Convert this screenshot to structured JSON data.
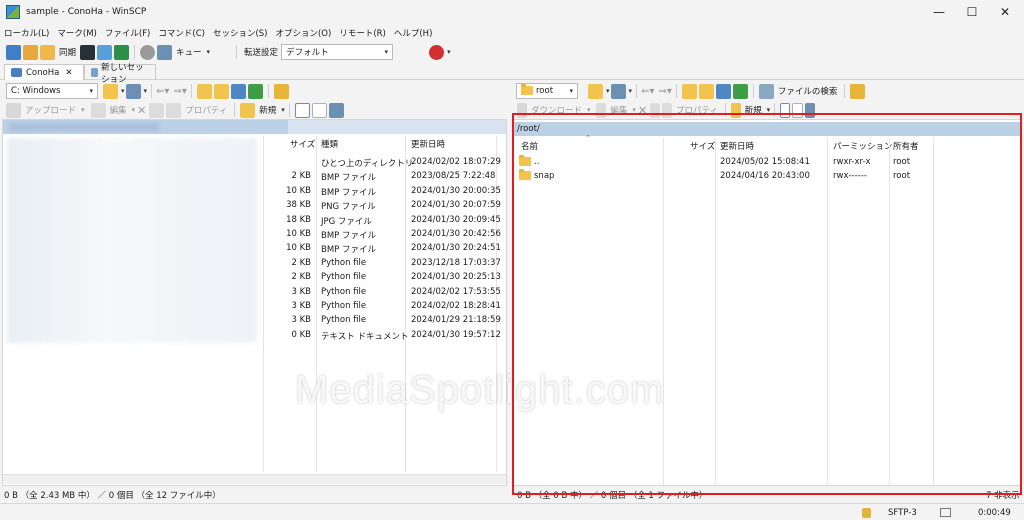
{
  "window": {
    "title": "sample - ConoHa - WinSCP",
    "minimize": "—",
    "maximize": "☐",
    "close": "✕"
  },
  "menu": [
    "ローカル(L)",
    "マーク(M)",
    "ファイル(F)",
    "コマンド(C)",
    "セッション(S)",
    "オプション(O)",
    "リモート(R)",
    "ヘルプ(H)"
  ],
  "toolbar_main": {
    "sync_label": "同期",
    "queue_label": "キュー",
    "transfer_label": "転送設定",
    "transfer_value": "デフォルト"
  },
  "tabs": {
    "session": "ConoHa",
    "session_close": "✕",
    "new_session": "新しいセッション"
  },
  "local": {
    "drive": "C: Windows",
    "upload": "アップロード",
    "edit": "編集",
    "properties": "プロパティ",
    "new": "新規",
    "columns": {
      "size": "サイズ",
      "type": "種類",
      "modified": "更新日時"
    },
    "rows": [
      {
        "size": "",
        "type": "ひとつ上のディレクトリ",
        "modified": "2024/02/02  18:07:29"
      },
      {
        "size": "2 KB",
        "type": "BMP ファイル",
        "modified": "2023/08/25   7:22:48"
      },
      {
        "size": "10 KB",
        "type": "BMP ファイル",
        "modified": "2024/01/30  20:00:35"
      },
      {
        "size": "38 KB",
        "type": "PNG ファイル",
        "modified": "2024/01/30  20:07:59"
      },
      {
        "size": "18 KB",
        "type": "JPG ファイル",
        "modified": "2024/01/30  20:09:45"
      },
      {
        "size": "10 KB",
        "type": "BMP ファイル",
        "modified": "2024/01/30  20:42:56"
      },
      {
        "size": "10 KB",
        "type": "BMP ファイル",
        "modified": "2024/01/30  20:24:51"
      },
      {
        "size": "2 KB",
        "type": "Python file",
        "modified": "2023/12/18  17:03:37"
      },
      {
        "size": "2 KB",
        "type": "Python file",
        "modified": "2024/01/30  20:25:13"
      },
      {
        "size": "3 KB",
        "type": "Python file",
        "modified": "2024/02/02  17:53:55"
      },
      {
        "size": "3 KB",
        "type": "Python file",
        "modified": "2024/02/02  18:28:41"
      },
      {
        "size": "3 KB",
        "type": "Python file",
        "modified": "2024/01/29  21:18:59"
      },
      {
        "size": "0 KB",
        "type": "テキスト ドキュメント",
        "modified": "2024/01/30  19:57:12"
      }
    ],
    "status": "0 B （全 2.43 MB 中） ／ 0 個目 （全 12 ファイル中）"
  },
  "remote": {
    "dir": "root",
    "find_files": "ファイルの検索",
    "download": "ダウンロード",
    "edit": "編集",
    "properties": "プロパティ",
    "new": "新規",
    "path": "/root/",
    "columns": {
      "name": "名前",
      "size": "サイズ",
      "modified": "更新日時",
      "permissions": "パーミッション",
      "owner": "所有者"
    },
    "rows": [
      {
        "name": "..",
        "size": "",
        "modified": "2024/05/02 15:08:41",
        "permissions": "rwxr-xr-x",
        "owner": "root"
      },
      {
        "name": "snap",
        "size": "",
        "modified": "2024/04/16 20:43:00",
        "permissions": "rwx------",
        "owner": "root"
      }
    ],
    "status": "0 B （全 0 B 中） ／ 0 個目 （全 1 ファイル中）",
    "hidden": "7 非表示"
  },
  "bottom": {
    "protocol": "SFTP-3",
    "timer": "0:00:49"
  },
  "watermark": "MediaSpotlight.com",
  "colors": {
    "path_bar": "#bcd0e6",
    "highlight": "#e11d1d",
    "folder": "#f2c34d"
  }
}
